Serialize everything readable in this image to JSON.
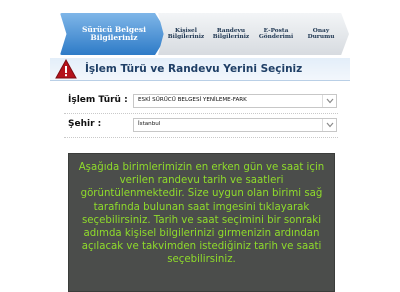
{
  "wizard": {
    "active_step": "Sürücü Belgesi Bilgileriniz",
    "steps": [
      {
        "line1": "Sürücü Belgesi",
        "line2": "Bilgileriniz"
      },
      {
        "line1": "Kişisel",
        "line2": "Bilgileriniz"
      },
      {
        "line1": "Randevu",
        "line2": "Bilgileriniz"
      },
      {
        "line1": "E-Posta",
        "line2": "Gönderimi"
      },
      {
        "line1": "Onay",
        "line2": "Durumu"
      }
    ]
  },
  "header": {
    "title": "İşlem Türü ve Randevu Yerini Seçiniz"
  },
  "form": {
    "islem_turu": {
      "label": "İşlem Türü :",
      "value": "ESKİ SÜRÜCÜ BELGESİ YENİLEME-FARK"
    },
    "sehir": {
      "label": "Şehir :",
      "value": "İstanbul"
    }
  },
  "info": {
    "text": "Aşağıda birimlerimizin en erken gün ve saat için verilen randevu tarih ve saatleri görüntülenmektedir. Size uygun olan birimi sağ tarafında bulunan saat imgesini tıklayarak seçebilirsiniz. Tarih ve saat seçimini bir sonraki adımda kişisel bilgilerinizi girmenizin ardından açılacak ve takvimden istediğiniz tarih ve saati seçebilirsiniz."
  },
  "colors": {
    "active_step": "#2e7bc7",
    "info_bg": "#4b4d4b",
    "info_text": "#8fdc2b",
    "warning": "#b5121b"
  },
  "icons": {
    "header_icon": "warning-icon",
    "select_arrow": "chevron-down-icon"
  }
}
